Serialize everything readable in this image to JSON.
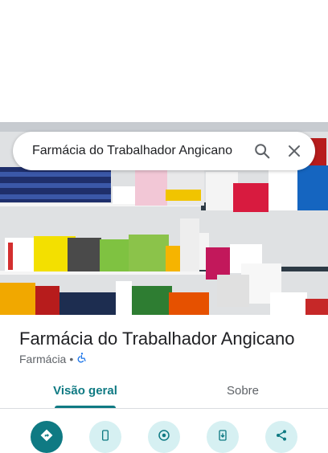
{
  "search": {
    "query": "Farmácia do Trabalhador Angicano"
  },
  "place": {
    "name": "Farmácia do Trabalhador Angicano",
    "category": "Farmácia",
    "separator": "•"
  },
  "tabs": [
    {
      "label": "Visão geral"
    },
    {
      "label": "Sobre"
    }
  ],
  "actions": [
    {
      "icon": "directions-icon"
    },
    {
      "icon": "phone-icon"
    },
    {
      "icon": "save-icon"
    },
    {
      "icon": "send-to-phone-icon"
    },
    {
      "icon": "share-icon"
    }
  ],
  "colors": {
    "accent": "#0f7a83",
    "action_bg": "#d6f0f2"
  }
}
